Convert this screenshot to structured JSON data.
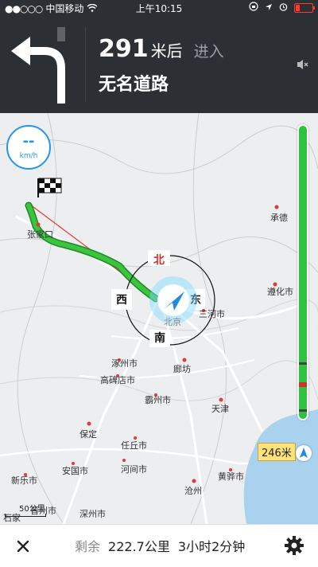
{
  "status_bar": {
    "carrier": "中国移动",
    "time": "上午10:15",
    "battery_level": 0.25,
    "battery_color": "#ff3b30"
  },
  "nav_header": {
    "turn_icon": "turn-left-arrow-icon",
    "distance_value": "291",
    "distance_unit": "米后",
    "action": "进入",
    "road_name": "无名道路",
    "mute_icon": "speaker-mute-icon"
  },
  "speed": {
    "value": "--",
    "unit": "km/h"
  },
  "map": {
    "compass": {
      "north": "北",
      "east": "东",
      "south": "南",
      "west": "西"
    },
    "cities": [
      "承德",
      "张家口",
      "遵化市",
      "三河市",
      "北京",
      "廊坊",
      "涿州市",
      "高碑店市",
      "霸州市",
      "天津",
      "保定",
      "任丘市",
      "安国市",
      "河间市",
      "黄骅市",
      "新乐市",
      "沧州",
      "深州市",
      "晋州市",
      "石家"
    ],
    "route_color": "#3cc53c",
    "destination_icon": "checkered-flag-icon",
    "vehicle_icon": "navigation-arrow-icon"
  },
  "route_progress": {
    "remaining_distance_label": "246米",
    "progress_fraction": 0.0,
    "accent_color": "#2fc13f"
  },
  "scale": {
    "label": "50公里"
  },
  "bottom_bar": {
    "remaining_label": "剩余",
    "distance": "222.7公里",
    "duration": "3小时2分钟",
    "close_icon": "close-icon",
    "settings_icon": "gear-icon"
  }
}
